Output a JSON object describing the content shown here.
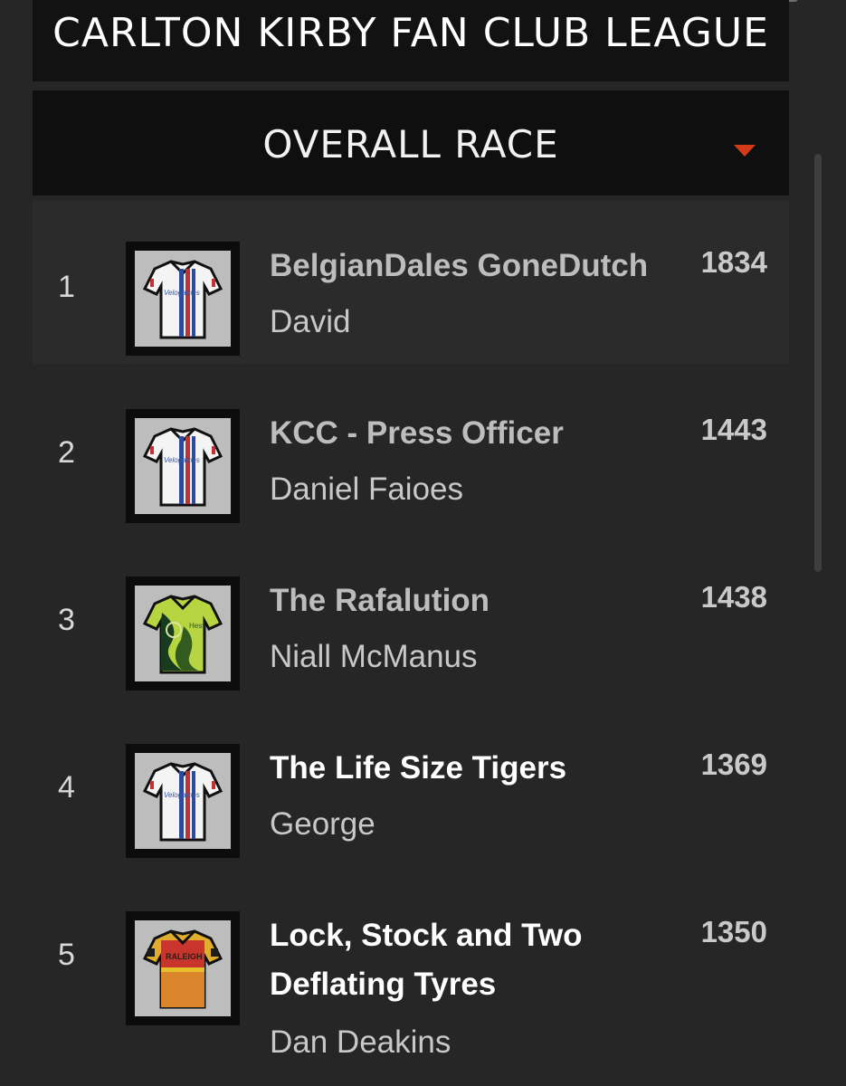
{
  "league": {
    "title": "CARLTON KIRBY FAN CLUB LEAGUE"
  },
  "race_selector": {
    "selected": "OVERALL RACE",
    "caret_icon": "caret-down-icon",
    "caret_color": "#d33a16"
  },
  "standings": [
    {
      "rank": "1",
      "team": "BelgianDales GoneDutch",
      "manager": "David",
      "points": "1834",
      "jersey_icon": "velogames-jersey-icon"
    },
    {
      "rank": "2",
      "team": "KCC - Press Officer",
      "manager": "Daniel Faioes",
      "points": "1443",
      "jersey_icon": "velogames-jersey-icon"
    },
    {
      "rank": "3",
      "team": "The Rafalution",
      "manager": "Niall McManus",
      "points": "1438",
      "jersey_icon": "hess-jersey-icon"
    },
    {
      "rank": "4",
      "team": "The Life Size Tigers",
      "manager": "George",
      "points": "1369",
      "jersey_icon": "velogames-jersey-icon"
    },
    {
      "rank": "5",
      "team": "Lock, Stock and Two Deflating Tyres",
      "manager": "Dan Deakins",
      "points": "1350",
      "jersey_icon": "raleigh-jersey-icon"
    }
  ],
  "jersey_text": {
    "velogames": "Velogames",
    "hess": "Hess",
    "raleigh": "RALEIGH"
  },
  "colors": {
    "background": "#262626",
    "header_background": "#121212",
    "selector_background": "#0f0f0f",
    "text_primary": "#ffffff",
    "text_secondary": "#c8c8c8"
  }
}
